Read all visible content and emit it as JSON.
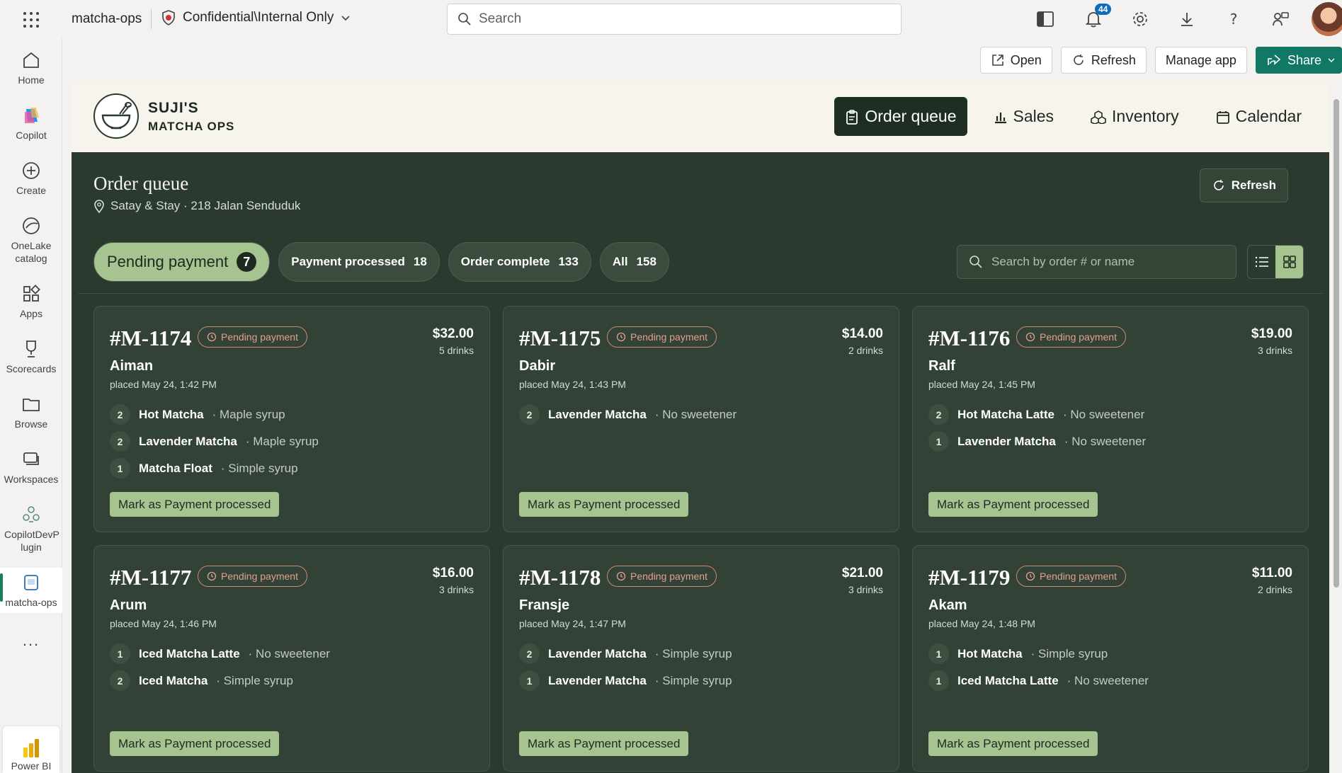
{
  "topbar": {
    "workspace_name": "matcha-ops",
    "sensitivity_label": "Confidential\\Internal Only",
    "search_placeholder": "Search",
    "notifications_count": "44"
  },
  "rail": {
    "items": [
      {
        "label": "Home",
        "icon": "home-icon"
      },
      {
        "label": "Copilot",
        "icon": "copilot-icon"
      },
      {
        "label": "Create",
        "icon": "create-icon"
      },
      {
        "label": "OneLake catalog",
        "icon": "onelake-icon"
      },
      {
        "label": "Apps",
        "icon": "apps-icon"
      },
      {
        "label": "Scorecards",
        "icon": "scorecards-icon"
      },
      {
        "label": "Browse",
        "icon": "browse-icon"
      },
      {
        "label": "Workspaces",
        "icon": "workspaces-icon"
      },
      {
        "label": "CopilotDevP lugin",
        "icon": "plugin-icon"
      },
      {
        "label": "matcha-ops",
        "icon": "matcha-ops-icon"
      }
    ],
    "more": "...",
    "powerbi_label": "Power BI"
  },
  "action_bar": {
    "open": "Open",
    "refresh": "Refresh",
    "manage_app": "Manage app",
    "share": "Share"
  },
  "app": {
    "brand_line1": "SUJI'S",
    "brand_line2": "MATCHA OPS",
    "nav": [
      {
        "label": "Order queue",
        "active": true
      },
      {
        "label": "Sales",
        "active": false
      },
      {
        "label": "Inventory",
        "active": false
      },
      {
        "label": "Calendar",
        "active": false
      }
    ],
    "page_title": "Order queue",
    "location": "Satay & Stay · 218 Jalan Senduduk",
    "refresh_label": "Refresh",
    "tabs": [
      {
        "label": "Pending payment",
        "count": "7"
      },
      {
        "label": "Payment processed",
        "count": "18"
      },
      {
        "label": "Order complete",
        "count": "133"
      },
      {
        "label": "All",
        "count": "158"
      }
    ],
    "order_search_placeholder": "Search by order # or name",
    "status_color": "#e3a08b",
    "accent_color": "#a6c48f",
    "orders": [
      {
        "id": "#M-1174",
        "status": "Pending payment",
        "total": "$32.00",
        "drinks": "5 drinks",
        "name": "Aiman",
        "placed": "placed May 24, 1:42 PM",
        "items": [
          {
            "qty": "2",
            "drink": "Hot Matcha",
            "mod": "· Maple syrup"
          },
          {
            "qty": "2",
            "drink": "Lavender Matcha",
            "mod": "· Maple syrup"
          },
          {
            "qty": "1",
            "drink": "Matcha Float",
            "mod": "· Simple syrup"
          }
        ],
        "action": "Mark as Payment processed"
      },
      {
        "id": "#M-1175",
        "status": "Pending payment",
        "total": "$14.00",
        "drinks": "2 drinks",
        "name": "Dabir",
        "placed": "placed May 24, 1:43 PM",
        "items": [
          {
            "qty": "2",
            "drink": "Lavender Matcha",
            "mod": "· No sweetener"
          }
        ],
        "action": "Mark as Payment processed"
      },
      {
        "id": "#M-1176",
        "status": "Pending payment",
        "total": "$19.00",
        "drinks": "3 drinks",
        "name": "Ralf",
        "placed": "placed May 24, 1:45 PM",
        "items": [
          {
            "qty": "2",
            "drink": "Hot Matcha Latte",
            "mod": "· No sweetener"
          },
          {
            "qty": "1",
            "drink": "Lavender Matcha",
            "mod": "· No sweetener"
          }
        ],
        "action": "Mark as Payment processed"
      },
      {
        "id": "#M-1177",
        "status": "Pending payment",
        "total": "$16.00",
        "drinks": "3 drinks",
        "name": "Arum",
        "placed": "placed May 24, 1:46 PM",
        "items": [
          {
            "qty": "1",
            "drink": "Iced Matcha Latte",
            "mod": "· No sweetener"
          },
          {
            "qty": "2",
            "drink": "Iced Matcha",
            "mod": "· Simple syrup"
          }
        ],
        "action": "Mark as Payment processed"
      },
      {
        "id": "#M-1178",
        "status": "Pending payment",
        "total": "$21.00",
        "drinks": "3 drinks",
        "name": "Fransje",
        "placed": "placed May 24, 1:47 PM",
        "items": [
          {
            "qty": "2",
            "drink": "Lavender Matcha",
            "mod": "· Simple syrup"
          },
          {
            "qty": "1",
            "drink": "Lavender Matcha",
            "mod": "· Simple syrup"
          }
        ],
        "action": "Mark as Payment processed"
      },
      {
        "id": "#M-1179",
        "status": "Pending payment",
        "total": "$11.00",
        "drinks": "2 drinks",
        "name": "Akam",
        "placed": "placed May 24, 1:48 PM",
        "items": [
          {
            "qty": "1",
            "drink": "Hot Matcha",
            "mod": "· Simple syrup"
          },
          {
            "qty": "1",
            "drink": "Iced Matcha Latte",
            "mod": "· No sweetener"
          }
        ],
        "action": "Mark as Payment processed"
      }
    ]
  }
}
